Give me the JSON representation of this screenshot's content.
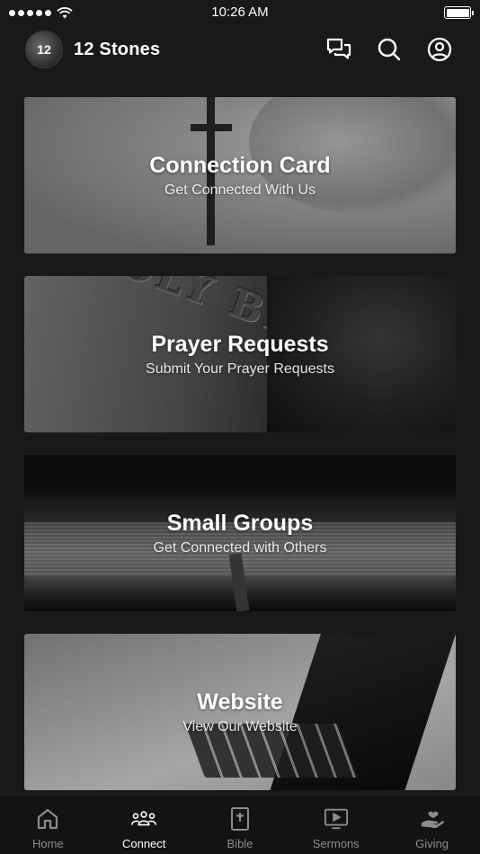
{
  "status_bar": {
    "time": "10:26 AM"
  },
  "header": {
    "logo_text": "12",
    "title": "12 Stones",
    "actions": [
      {
        "name": "chat-icon"
      },
      {
        "name": "search-icon"
      },
      {
        "name": "profile-icon"
      }
    ]
  },
  "cards": [
    {
      "title": "Connection Card",
      "subtitle": "Get Connected With Us"
    },
    {
      "title": "Prayer Requests",
      "subtitle": "Submit Your Prayer Requests"
    },
    {
      "title": "Small Groups",
      "subtitle": "Get Connected with Others"
    },
    {
      "title": "Website",
      "subtitle": "View Our Website"
    }
  ],
  "bible_cover_text": "HOLY BIBLE",
  "tabs": [
    {
      "label": "Home",
      "icon": "home-icon",
      "active": false
    },
    {
      "label": "Connect",
      "icon": "people-icon",
      "active": true
    },
    {
      "label": "Bible",
      "icon": "bible-icon",
      "active": false
    },
    {
      "label": "Sermons",
      "icon": "tv-play-icon",
      "active": false
    },
    {
      "label": "Giving",
      "icon": "giving-hand-icon",
      "active": false
    }
  ]
}
